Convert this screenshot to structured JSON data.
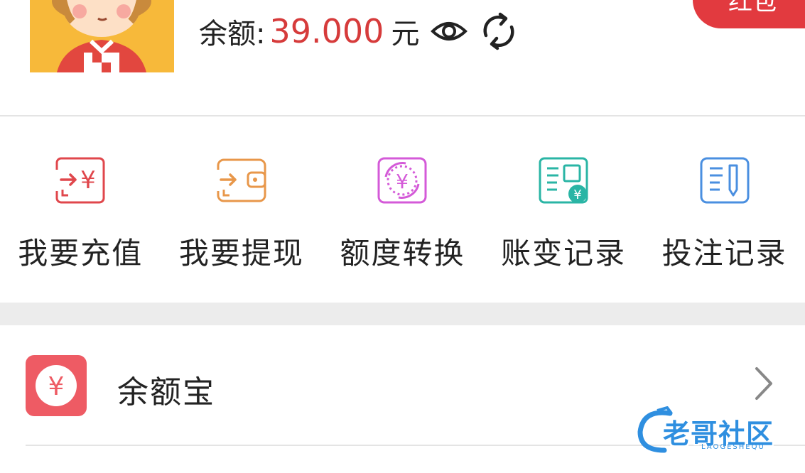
{
  "header": {
    "balance_label": "余额:",
    "balance_value": "39.000",
    "balance_unit": "元",
    "redpacket_label": "红包"
  },
  "actions": [
    {
      "label": "我要充值",
      "icon": "recharge-icon",
      "color": "#e0474c"
    },
    {
      "label": "我要提现",
      "icon": "withdraw-wallet-icon",
      "color": "#e8974a"
    },
    {
      "label": "额度转换",
      "icon": "quota-exchange-icon",
      "color": "#d45ad8"
    },
    {
      "label": "账变记录",
      "icon": "account-change-icon",
      "color": "#2ab5a5"
    },
    {
      "label": "投注记录",
      "icon": "bet-record-icon",
      "color": "#4a8fe0"
    }
  ],
  "list": {
    "yuebao_label": "余额宝",
    "yuebao_icon_symbol": "¥"
  },
  "watermark": {
    "text": "老哥社区",
    "sub": "LAOGESHEQU"
  },
  "colors": {
    "accent_red": "#e23a3f",
    "balance_red": "#d63b3b",
    "gray_band": "#ececec"
  }
}
